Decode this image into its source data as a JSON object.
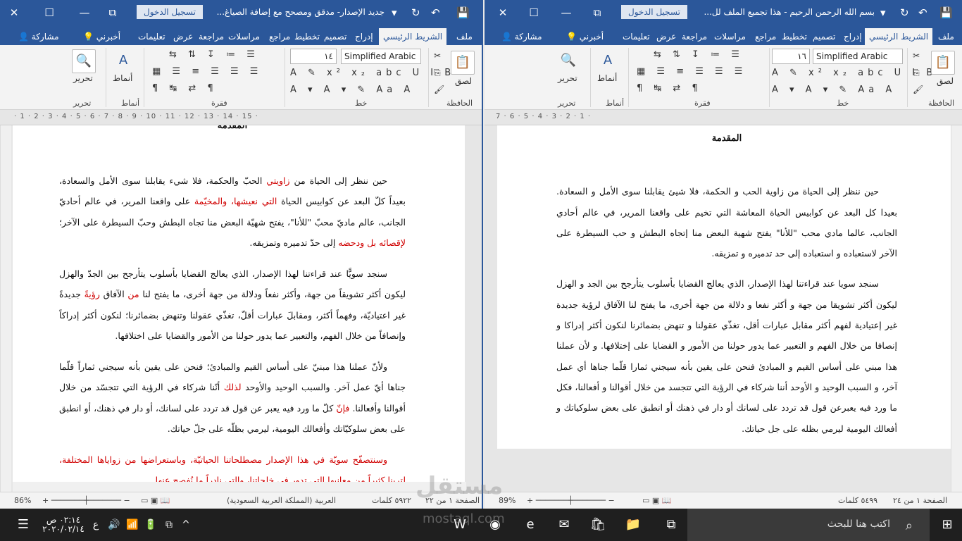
{
  "left_window": {
    "title": "جديد الإصدار- مدقق ومصحح مع إضافة الصياغ...",
    "signin": "تسجيل الدخول",
    "tabs": [
      "ملف",
      "الشريط الرئيسي",
      "إدراج",
      "تصميم",
      "تخطيط",
      "مراجع",
      "مراسلات",
      "مراجعة",
      "عرض",
      "تعليمات"
    ],
    "tell_me": "أخبرني",
    "share": "مشاركة",
    "font_name": "Simplified Arabic",
    "font_size": "١٤",
    "groups": [
      "الحافظة",
      "خط",
      "فقرة",
      "أنماط",
      "تحرير"
    ],
    "paste": "لصق",
    "styles": "أنماط",
    "editing": "تحرير",
    "ruler": "· 1 · 2 · 3 · 4 · 5 · 6 · 7 · 8 · 9 · 10 · 11 · 12 · 13 · 14 · 15 ·",
    "heading": "المقدمة",
    "paragraphs": [
      [
        {
          "t": "حين ننظر إلى الحياة من ",
          "red": false
        },
        {
          "t": "زاويتي",
          "red": true
        },
        {
          "t": " الحبّ والحكمة، فلا شيء يقابلنا سوى الأمل والسعادة، بعيداً كلّ البعد عن كوابيس الحياة ",
          "red": false
        },
        {
          "t": "التي نعيشها، والمخيّمة",
          "red": true
        },
        {
          "t": " على واقعنا المرير، في عالم أحاديّ الجانب، عالم ماديّ محبّ \"للأنا\"، يفتح شهيّة البعض منا تجاه البطش وحبّ السيطرة على الآخر؛ ",
          "red": false
        },
        {
          "t": "لإقصائه بل ودحضه",
          "red": true
        },
        {
          "t": " إلى حدّ تدميره وتمزيقه.",
          "red": false
        }
      ],
      [
        {
          "t": "سنجد سويًّا عند قراءتنا لهذا الإصدار، الذي يعالج القضايا بأسلوب يتأرجح بين الجدّ والهزل ليكون أكثر تشويقاً من جهة، وأكثر نفعاً ودلالة من جهة أخرى، ما يفتح لنا ",
          "red": false
        },
        {
          "t": "من",
          "red": true
        },
        {
          "t": " الآفاق ",
          "red": false
        },
        {
          "t": "رؤيةً",
          "red": true
        },
        {
          "t": " جديدةً غير اعتياديّة، وفهماً أكثر، ومقابلَ عبارات أقلّ، تغذّي عقولنا وتنهض بضمائرنا؛ لنكون أكثر إدراكاً وإنصافاً من خلال الفهم، والتعبير عما يدور حولنا من الأمور والقضايا على اختلافها.",
          "red": false
        }
      ],
      [
        {
          "t": "ولأنّ عملنا هذا مبنيّ على أساس القيم والمبادئ؛ فنحن على يقين بأنه سيجني ثماراً قلّما جناها أيّ عمل آخر. والسبب الوحيد والأوحد ",
          "red": false
        },
        {
          "t": "لذلك",
          "red": true
        },
        {
          "t": " أنّنا شركاء في الرؤية التي تتجسّد من خلال أقوالنا وأفعالنا. ",
          "red": false
        },
        {
          "t": "فإنّ",
          "red": true
        },
        {
          "t": " كلّ ما ورد فيه يعبر عن قول قد تردد على لسانك، أو دار في ذهنك، أو انطبق على بعض سلوكيّاتك وأفعالك اليومية، ليرمي بظلّه على جلّ حياتك.",
          "red": false
        }
      ],
      [
        {
          "t": "وسنتصفّح سويّة في هذا الإصدار مصطلحاتنا الحياتيّة، وباستعراضها من زواياها المختلفة، لترينا كثيراً من معانيها التي تدور في خلجاتنا، والتي نادراً ما نُفصح عنها.",
          "red": true
        }
      ]
    ],
    "status": {
      "page": "الصفحة ١ من ٢٢",
      "words": "٥٩٢٢ كلمات",
      "language": "العربية (المملكة العربية السعودية)",
      "zoom": "86%"
    }
  },
  "right_window": {
    "title": "بسم الله الرحمن الرحيم - هذا تجميع الملف لل...",
    "signin": "تسجيل الدخول",
    "tabs": [
      "ملف",
      "الشريط الرئيسي",
      "إدراج",
      "تصميم",
      "تخطيط",
      "مراجع",
      "مراسلات",
      "مراجعة",
      "عرض",
      "تعليمات"
    ],
    "tell_me": "أخبرني",
    "share": "مشاركة",
    "font_name": "Simplified Arabic",
    "font_size": "١٦",
    "groups": [
      "الحافظة",
      "خط",
      "فقرة",
      "أنماط",
      "تحرير"
    ],
    "paste": "لصق",
    "styles": "أنماط",
    "editing": "تحرير",
    "ruler": "7 · 6 · 5 · 4 · 3 · 2 · 1 ·",
    "heading": "المقدمة",
    "paragraphs": [
      "حين ننظر إلى الحياة من زاوية الحب و الحكمة، فلا شيئ يقابلنا سوى الأمل و السعادة. بعيدا كل البعد عن كوابيس الحياة المعاشة التي تخيم على واقعنا المرير، في عالم أحادي الجانب، عالما مادي محب \"للأنا\" يفتح شهية البعض منا إتجاه البطش و حب السيطرة على الآخر لاستعباده و استعباده إلى حد تدميره و تمزيقه.",
      "سنجد سويا عند قراءتنا لهذا الإصدار، الذي يعالج القضايا بأسلوب يتأرجح بين الجد و الهزل ليكون أكثر تشويقا من جهة و أكثر نفعا و دلالة من جهة أخرى، ما يفتح لنا الآفاق لرؤية جديدة غير إعتيادية لفهم أكثر مقابل عبارات أقل، تغذّي عقولنا و تنهض بضمائرنا لنكون أكثر إدراكا و إنصافا من خلال الفهم و التعبير عما يدور حولنا من الأمور و القضايا على إختلافها. و لأن عملنا هذا مبني على أساس القيم و المبادئ فنحن على يقين بأنه سيجني ثمارا قلّما جناها أي عمل آخر، و السبب الوحيد و الأوحد أننا شركاء في الرؤية التي تتجسد من خلال أقوالنا و أفعالنا، فكل ما ورد فيه يعبرعن قول قد تردد على لسانك أو دار في ذهنك أو انطبق على بعض سلوكياتك و أفعالك اليومية ليرمي بظله على جل حياتك."
    ],
    "status": {
      "page": "الصفحة ١ من ٢٤",
      "words": "٥٤٩٩ كلمات",
      "zoom": "89%"
    }
  },
  "taskbar": {
    "search_placeholder": "اكتب هنا للبحث",
    "time": "٠٢:١٤ ص",
    "date": "٢٠٢٠/٠٢/١٤",
    "lang": "ع"
  },
  "watermark": {
    "brand": "مستقل",
    "domain": "mostaql.com"
  }
}
